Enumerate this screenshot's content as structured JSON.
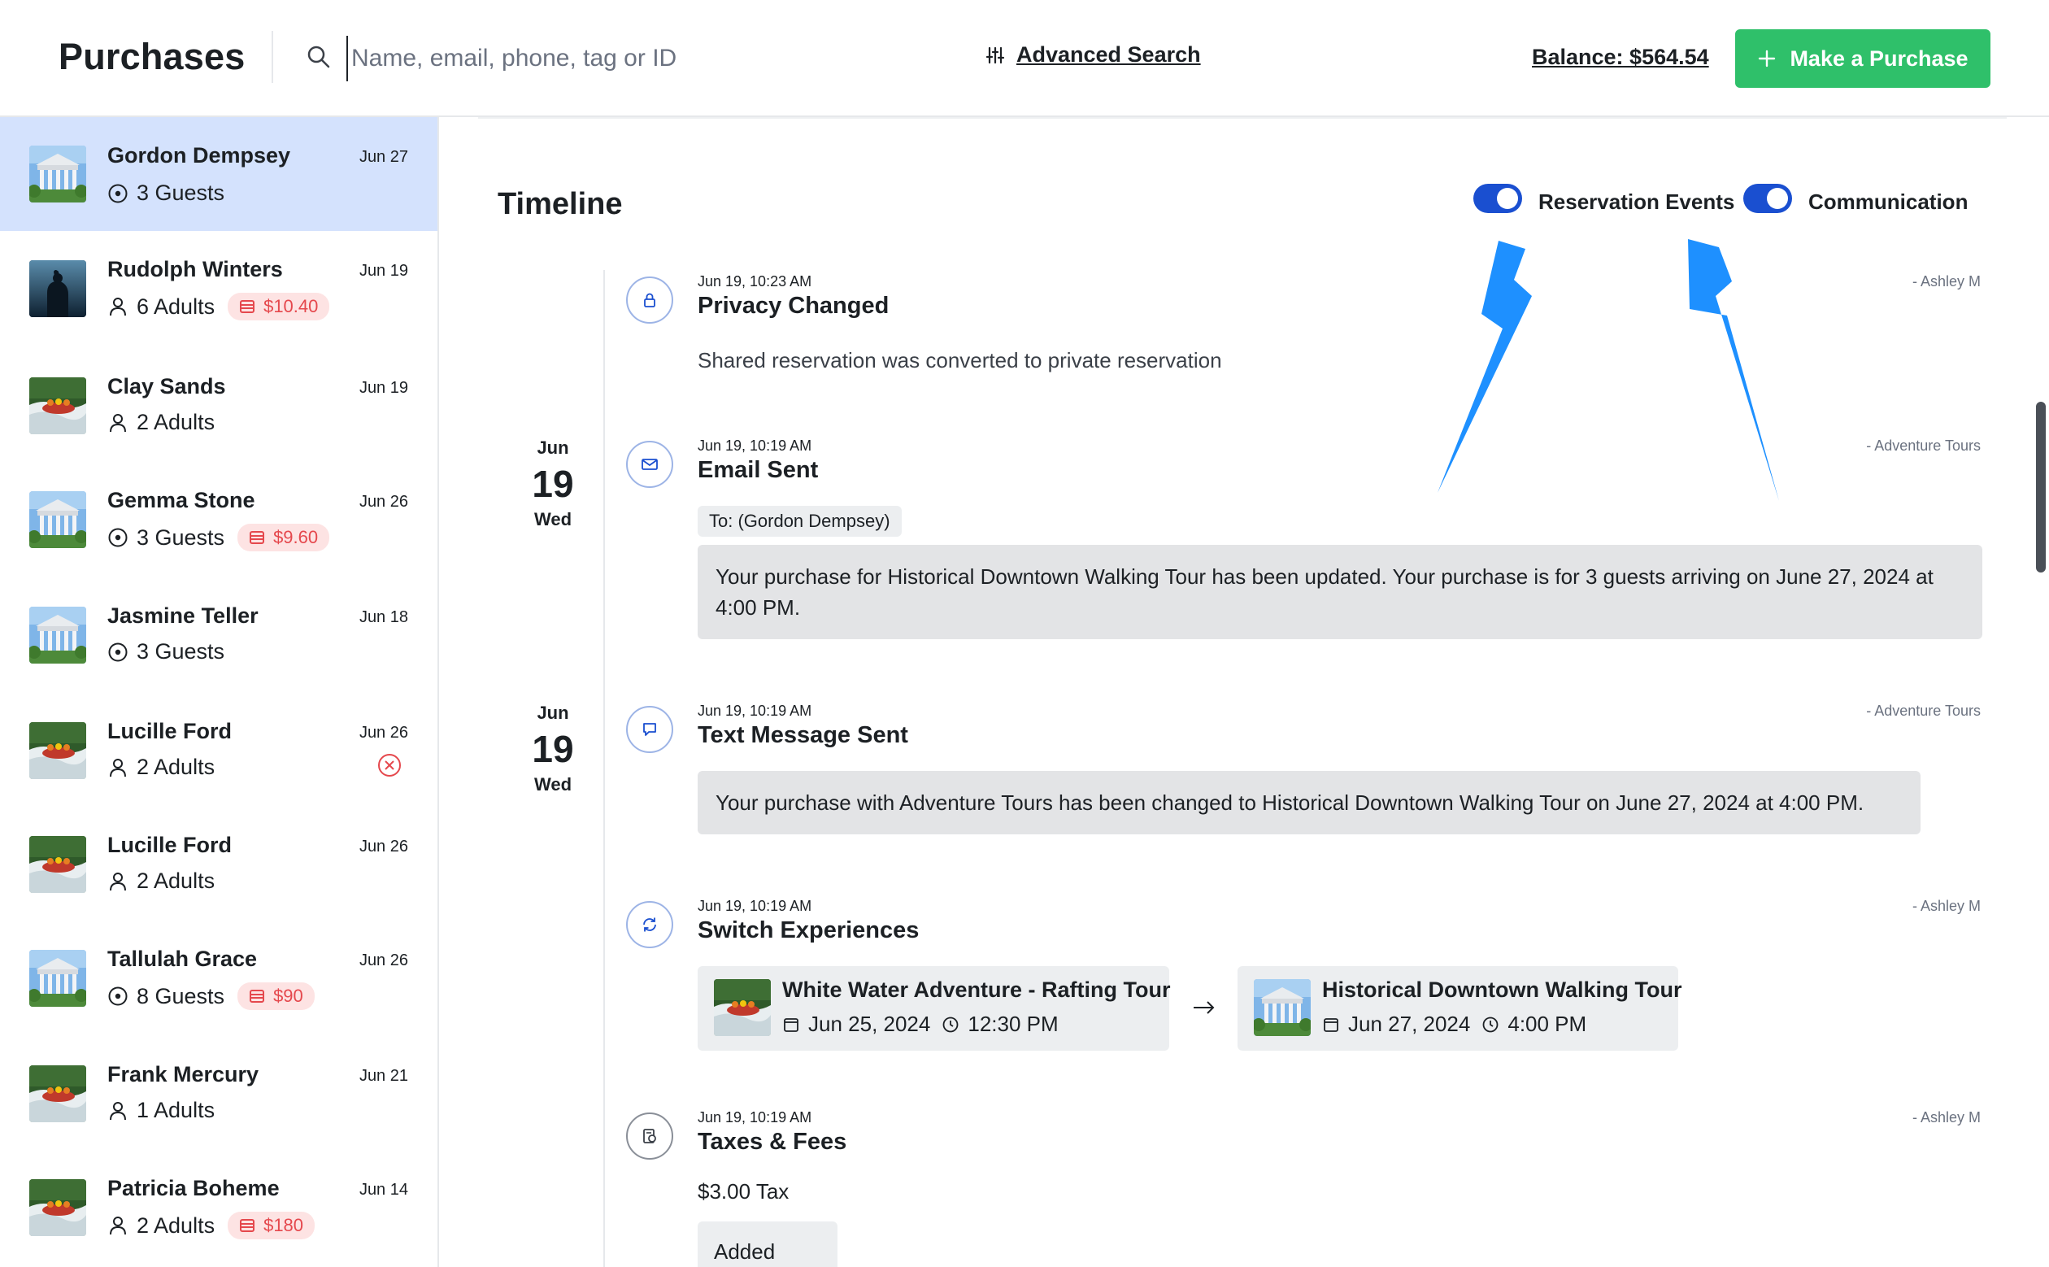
{
  "header": {
    "title": "Purchases",
    "search_placeholder": "Name, email, phone, tag or ID",
    "search_value": "",
    "advanced_search_label": "Advanced Search",
    "balance_label": "Balance: $564.54",
    "make_purchase_label": "Make a Purchase"
  },
  "sidebar": {
    "items": [
      {
        "name": "Gordon Dempsey",
        "date": "Jun 27",
        "meta": "3 Guests",
        "meta_icon": "target-icon",
        "thumb": "building-thumbnail",
        "selected": true
      },
      {
        "name": "Rudolph Winters",
        "date": "Jun 19",
        "meta": "6 Adults",
        "meta_icon": "person-icon",
        "badge": "$10.40",
        "thumb": "dark-silhouette-thumbnail"
      },
      {
        "name": "Clay Sands",
        "date": "Jun 19",
        "meta": "2 Adults",
        "meta_icon": "person-icon",
        "thumb": "rafting-thumbnail"
      },
      {
        "name": "Gemma Stone",
        "date": "Jun 26",
        "meta": "3 Guests",
        "meta_icon": "target-icon",
        "badge": "$9.60",
        "thumb": "building-thumbnail"
      },
      {
        "name": "Jasmine Teller",
        "date": "Jun 18",
        "meta": "3 Guests",
        "meta_icon": "target-icon",
        "thumb": "building-thumbnail"
      },
      {
        "name": "Lucille Ford",
        "date": "Jun 26",
        "meta": "2 Adults",
        "meta_icon": "person-icon",
        "status": "cancelled",
        "thumb": "rafting-thumbnail"
      },
      {
        "name": "Lucille Ford",
        "date": "Jun 26",
        "meta": "2 Adults",
        "meta_icon": "person-icon",
        "thumb": "rafting-thumbnail"
      },
      {
        "name": "Tallulah Grace",
        "date": "Jun 26",
        "meta": "8 Guests",
        "meta_icon": "target-icon",
        "badge": "$90",
        "thumb": "building-thumbnail"
      },
      {
        "name": "Frank Mercury",
        "date": "Jun 21",
        "meta": "1 Adults",
        "meta_icon": "person-icon",
        "thumb": "rafting-thumbnail"
      },
      {
        "name": "Patricia Boheme",
        "date": "Jun 14",
        "meta": "2 Adults",
        "meta_icon": "person-icon",
        "badge": "$180",
        "thumb": "rafting-thumbnail"
      }
    ]
  },
  "timeline": {
    "title": "Timeline",
    "toggles": [
      {
        "label": "Reservation Events",
        "on": true
      },
      {
        "label": "Communication",
        "on": true
      }
    ],
    "days": [
      {
        "month": "Jun",
        "day": "19",
        "weekday": "Wed"
      },
      {
        "month": "Jun",
        "day": "19",
        "weekday": "Wed"
      }
    ],
    "events": [
      {
        "time": "Jun 19, 10:23 AM",
        "title": "Privacy Changed",
        "author": "- Ashley M",
        "icon": "lock-icon",
        "text": "Shared reservation was converted to private reservation"
      },
      {
        "time": "Jun 19, 10:19 AM",
        "title": "Email Sent",
        "author": "- Adventure Tours",
        "icon": "mail-icon",
        "to": "To: (Gordon Dempsey)",
        "message": "Your purchase for Historical Downtown Walking Tour has been updated. Your purchase is for 3 guests arriving on June 27, 2024 at 4:00 PM."
      },
      {
        "time": "Jun 19, 10:19 AM",
        "title": "Text Message Sent",
        "author": "- Adventure Tours",
        "icon": "chat-bubble-icon",
        "message": "Your purchase with Adventure Tours has been changed to Historical Downtown Walking Tour on June 27, 2024 at 4:00 PM."
      },
      {
        "time": "Jun 19, 10:19 AM",
        "title": "Switch Experiences",
        "author": "- Ashley M",
        "icon": "refresh-icon",
        "from": {
          "name": "White Water Adventure - Rafting Tour",
          "date": "Jun 25, 2024",
          "time": "12:30 PM"
        },
        "to": {
          "name": "Historical Downtown Walking Tour",
          "date": "Jun 27, 2024",
          "time": "4:00 PM"
        }
      },
      {
        "time": "Jun 19, 10:19 AM",
        "title": "Taxes & Fees",
        "author": "- Ashley M",
        "icon": "receipt-icon",
        "text": "$3.00 Tax",
        "status": "Added"
      }
    ]
  },
  "colors": {
    "accent_blue": "#1a4fd0",
    "selected_row": "#d4e2fd",
    "primary_green": "#2fc06a",
    "badge_red": "#e5484d",
    "badge_bg": "#fde3e3",
    "callout_arrow": "#1e90ff"
  }
}
